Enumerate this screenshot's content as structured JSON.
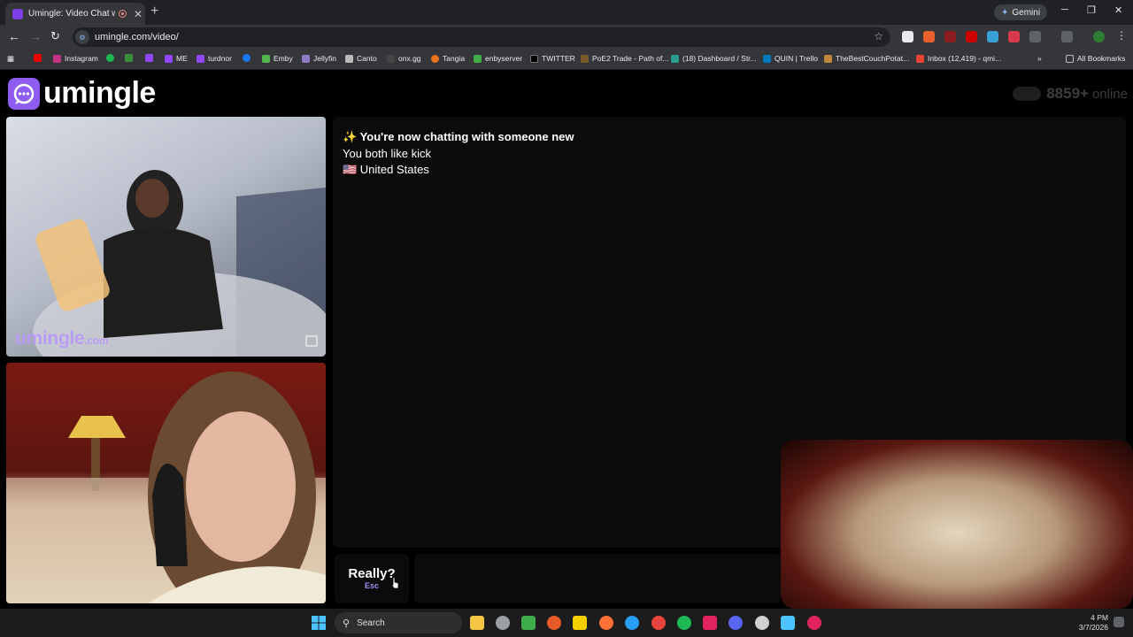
{
  "browser": {
    "tab_title": "Umingle: Video Chat with S",
    "tab_close": "✕",
    "new_tab": "+",
    "gemini_label": "Gemini",
    "url": "umingle.com/video/",
    "window_min": "─",
    "window_max": "❐",
    "window_close": "✕",
    "bookmarks": [
      "Instagram",
      "turdnor",
      "ME",
      "turdnor",
      "Emby",
      "Jellyfin",
      "Canto",
      "onx.gg",
      "Tangia",
      "enbyserver",
      "TWITTER",
      "PoE2 Trade - Path of...",
      "(18) Dashboard / Str...",
      "QUIN | Trello",
      "TheBestCouchPotat...",
      "Inbox (12,419) - qmi..."
    ],
    "all_bookmarks": "All Bookmarks"
  },
  "site": {
    "logo_text": "umingle",
    "online_count": "8859+",
    "online_label": "online",
    "watermark_main": "umingle",
    "watermark_tld": ".com"
  },
  "chat": {
    "intro": "✨ You're now chatting with someone new",
    "interest": "You both like kick",
    "country": "🇺🇸 United States"
  },
  "controls": {
    "esc_main": "Really?",
    "esc_hint": "Esc"
  },
  "taskbar": {
    "search_label": "Search",
    "time": "4 PM",
    "date": "3/7/2026"
  },
  "colors": {
    "brand": "#8e5cf0",
    "watermark": "#b99cf5",
    "esc_hint": "#a78bfa"
  }
}
